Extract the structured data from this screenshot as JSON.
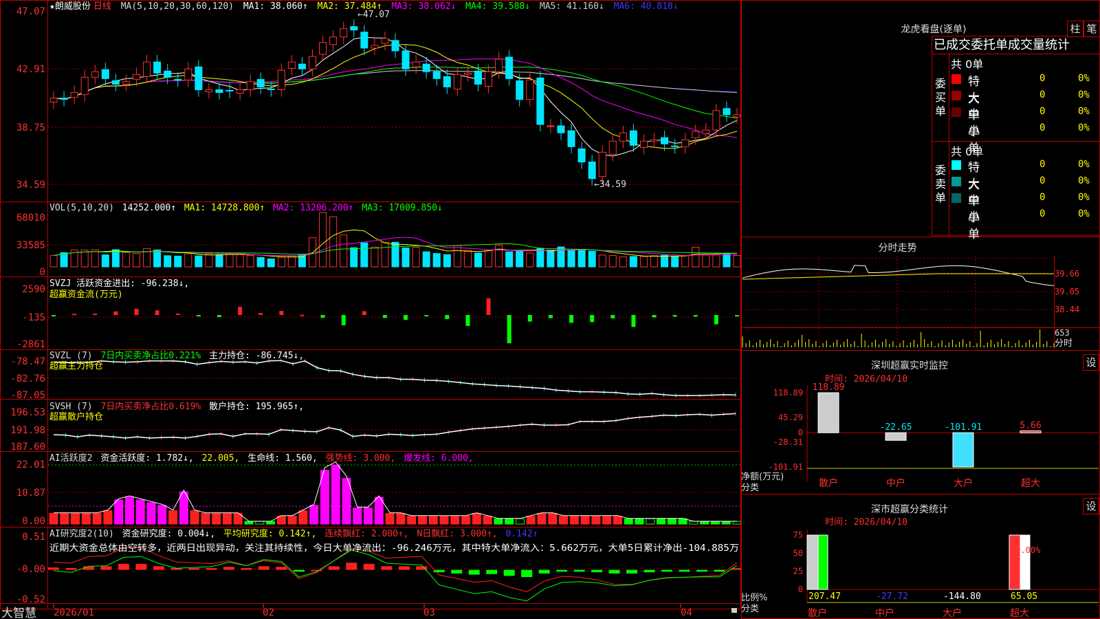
{
  "stock": {
    "star": "★",
    "name": "朗威股份",
    "period": "日线"
  },
  "price": {
    "header": {
      "ma_def": "MA(5,10,20,30,60,120)",
      "ma1": "MA1: 38.060↑",
      "ma2": "MA2: 37.484↑",
      "ma3": "MA3: 38.062↓",
      "ma4": "MA4: 39.588↓",
      "ma5": "MA5: 41.160↓",
      "ma6": "MA6: 40.818↓"
    },
    "y_ticks": [
      "47.07",
      "42.91",
      "38.75",
      "34.59"
    ],
    "high_label": "47.07",
    "low_label": "34.59"
  },
  "vol": {
    "header": {
      "def": "VOL(5,10,20)",
      "v": "14252.000↑",
      "ma1": "MA1: 14728.800↑",
      "ma2": "MA2: 13206.200↑",
      "ma3": "MA3: 17009.850↓"
    },
    "y_ticks": [
      "68010",
      "33585",
      "0"
    ]
  },
  "svzj": {
    "line1": "SVZJ  活跃资金进出: -96.238↓,",
    "line2": "超赢资金流(万元)",
    "y_ticks": [
      "2590",
      "-135",
      "-2861"
    ]
  },
  "svzl": {
    "h1": "SVZL (7)",
    "h2": "7日内买卖净占比0.221%",
    "h3": "主力持仓: -86.745↓,",
    "line2": "超赢主力持仓",
    "y_ticks": [
      "-78.47",
      "-82.76",
      "-87.05"
    ]
  },
  "svsh": {
    "h1": "SVSH (7)",
    "h2": "7日内买卖净占比0.619%",
    "h3": "散户持仓: 195.965↑,",
    "line2": "超赢散户持仓",
    "y_ticks": [
      "196.53",
      "191.98",
      "187.60"
    ]
  },
  "ai1": {
    "h1": "AI活跃度2",
    "h2": "资金活跃度: 1.782↓,",
    "h3": "22.005,",
    "h4": "生命线: 1.560,",
    "h5": "强势线: 3.000,",
    "h6": "爆发线: 6.000,",
    "y_ticks": [
      "22.01",
      "10.87",
      "0.00"
    ]
  },
  "ai2": {
    "h1": "AI研究度2(10)",
    "h2": "资金研究度: 0.004↓,",
    "h3": "平均研究度: 0.142↑,",
    "h4": "连续飘红: 2.000↑,",
    "h5": "N日飘红: 3.000↑,",
    "h6": "0.142↑",
    "note": "近期大资金总体由空转多，近两日出现异动，关注其持续性，今日大单净流出：-96.246万元，其中特大单净流入：5.662万元，大单5日累计净出-104.885万",
    "y_ticks": [
      "0.51",
      "-0.00",
      "-0.52"
    ]
  },
  "x_axis": [
    "2026/01",
    "02",
    "03",
    "04"
  ],
  "brand": "大智慧",
  "side": {
    "title": "龙虎看盘(逐单)",
    "btn1": "柱",
    "btn2": "笔",
    "table_title": "已成交委托单成交量统计",
    "buy": {
      "side": "委买单",
      "total": "共 0单",
      "rows": [
        {
          "label": "特大",
          "v": "0",
          "p": "0%",
          "color": "#ff0000"
        },
        {
          "label": "大单",
          "v": "0",
          "p": "0%",
          "color": "#990000"
        },
        {
          "label": "中单",
          "v": "0",
          "p": "0%",
          "color": "#660000"
        },
        {
          "label": "小单",
          "v": "0",
          "p": "0%",
          "color": "#000000"
        }
      ]
    },
    "sell": {
      "side": "委卖单",
      "total": "共 0单",
      "rows": [
        {
          "label": "特大",
          "v": "0",
          "p": "0%",
          "color": "#00ffff"
        },
        {
          "label": "大单",
          "v": "0",
          "p": "0%",
          "color": "#009999"
        },
        {
          "label": "中单",
          "v": "0",
          "p": "0%",
          "color": "#006666"
        },
        {
          "label": "小单",
          "v": "0",
          "p": "0%",
          "color": "#000000"
        }
      ]
    },
    "fenshi": {
      "title": "分时走势",
      "y_ticks": [
        "39.66",
        "39.05",
        "38.44"
      ],
      "vol_label": "653",
      "unit": "分时"
    },
    "monitor": {
      "title": "深圳超赢实时监控",
      "btn": "设",
      "date": "时间: 2026/04/10",
      "y_ticks": [
        "118.89",
        "45.29",
        "0",
        "-28.31",
        "-101.91"
      ],
      "unit1": "净额(万元)",
      "unit2": "分类",
      "cats": [
        "散户",
        "中户",
        "大户",
        "超大"
      ],
      "values": [
        118.89,
        -22.65,
        -101.91,
        5.66
      ],
      "labels": [
        "118.89",
        "-22.65",
        "-101.91",
        "5.66"
      ]
    },
    "classify": {
      "title": "深市超赢分类统计",
      "btn": "设",
      "date": "时间: 2026/04/10",
      "y_ticks": [
        "75",
        "50",
        "25",
        "0"
      ],
      "unit1": "比例%",
      "unit2": "分类",
      "cats": [
        "散户",
        "中户",
        "大户",
        "超大"
      ],
      "pcts": [
        100,
        0,
        0,
        100
      ],
      "labels": [
        "207.47",
        "-27.72",
        "-144.80",
        "65.05"
      ],
      "top_label": "+0.00%"
    }
  },
  "chart_data": [
    {
      "type": "candlestick",
      "title": "朗威股份 日线",
      "x": [
        "2026/01",
        "02",
        "03",
        "04"
      ],
      "ylim": [
        34.59,
        47.07
      ],
      "y_ticks": [
        47.07,
        42.91,
        38.75,
        34.59
      ],
      "high": 47.07,
      "low": 34.59,
      "close": [
        40.8,
        40.7,
        41.2,
        42.3,
        42.7,
        42.2,
        41.8,
        42.0,
        42.5,
        43.4,
        42.6,
        42.3,
        42.1,
        42.9,
        41.4,
        41.4,
        41.2,
        41.3,
        41.4,
        42.0,
        41.6,
        41.4,
        42.8,
        43.4,
        42.9,
        43.8,
        44.8,
        45.2,
        45.8,
        45.7,
        44.4,
        44.6,
        45.1,
        44.2,
        42.9,
        43.4,
        42.7,
        42.2,
        41.6,
        42.5,
        42.6,
        41.8,
        42.7,
        43.6,
        42.2,
        40.7,
        42.1,
        38.9,
        38.8,
        38.3,
        37.3,
        36.2,
        35.0,
        36.9,
        37.7,
        38.3,
        37.4,
        37.7,
        37.8,
        37.5,
        37.3,
        37.8,
        38.4,
        38.5,
        39.9,
        39.6,
        39.6
      ]
    },
    {
      "type": "bar",
      "title": "VOL(5,10,20)",
      "ylim": [
        0,
        68010
      ],
      "values": [
        14252,
        17800,
        21300,
        21000,
        21500,
        15000,
        21500,
        18000,
        16800,
        22900,
        21200,
        14000,
        13500,
        16400,
        13700,
        16400,
        15400,
        16100,
        15800,
        14200,
        11800,
        10000,
        12200,
        13500,
        15400,
        36500,
        68010,
        62700,
        40200,
        24000,
        30000,
        24800,
        30700,
        30800,
        23700,
        24500,
        18900,
        16700,
        15300,
        26500,
        20500,
        17300,
        20500,
        27300,
        18800,
        19800,
        17300,
        22800,
        20600,
        25000,
        20400,
        21600,
        19500,
        14700,
        14200,
        12500,
        13000,
        13000,
        14000,
        14500,
        13000,
        14000,
        24500,
        14700,
        15000,
        16500,
        14252
      ]
    },
    {
      "type": "bar",
      "title": "超赢资金流(万元)",
      "ylim": [
        -2861,
        2590
      ],
      "values": [
        -10,
        120,
        140,
        360,
        620,
        460,
        140,
        -40,
        -210,
        820,
        190,
        410,
        20,
        -270,
        -1010,
        380,
        -290,
        -490,
        -95,
        -400,
        -1080,
        1660,
        -2800,
        -650,
        -310,
        -770,
        -700,
        -340,
        -1180,
        -240,
        -160,
        -160,
        -920,
        -140
      ]
    },
    {
      "type": "line",
      "title": "超赢主力持仓",
      "ylim": [
        -87.05,
        -78.47
      ],
      "y_ticks": [
        -78.47,
        -82.76,
        -87.05
      ],
      "values": [
        -78.9,
        -79.0,
        -78.9,
        -78.9,
        -78.6,
        -78.8,
        -78.9,
        -78.8,
        -78.6,
        -78.6,
        -78.6,
        -78.8,
        -79.4,
        -79.0,
        -78.7,
        -78.9,
        -78.8,
        -79.1,
        -78.6,
        -78.5,
        -79.3,
        -78.6,
        -80.2,
        -80.9,
        -81.0,
        -81.8,
        -82.3,
        -82.6,
        -82.6,
        -83.0,
        -83.0,
        -83.2,
        -83.3,
        -83.5,
        -83.8,
        -84.1,
        -84.3,
        -84.5,
        -84.6,
        -84.8,
        -85.0,
        -85.2,
        -85.6,
        -85.8,
        -86.0,
        -86.0,
        -86.1,
        -86.2,
        -86.5,
        -86.6,
        -86.4,
        -86.7,
        -86.9,
        -86.9,
        -86.9,
        -86.8,
        -86.7,
        -86.745
      ]
    },
    {
      "type": "line",
      "title": "超赢散户持仓",
      "ylim": [
        187.6,
        196.53
      ],
      "y_ticks": [
        196.53,
        191.98,
        187.6
      ],
      "values": [
        190.9,
        190.8,
        190.4,
        190.8,
        190.6,
        190.4,
        190.1,
        190.4,
        190.1,
        190.2,
        190.3,
        190.1,
        190.5,
        191.0,
        191.1,
        190.5,
        191.1,
        191.1,
        191.0,
        192.1,
        191.9,
        191.7,
        191.6,
        192.6,
        192.0,
        190.5,
        190.8,
        190.6,
        191.0,
        190.9,
        190.7,
        190.9,
        191.0,
        191.5,
        191.9,
        192.3,
        192.5,
        192.7,
        192.9,
        193.2,
        193.4,
        193.2,
        193.2,
        193.3,
        194.1,
        194.1,
        194.1,
        194.3,
        194.8,
        195.1,
        195.3,
        195.6,
        195.5,
        195.7,
        195.8,
        195.6,
        195.8,
        195.965
      ]
    },
    {
      "type": "bar",
      "title": "AI活跃度2",
      "ylim": [
        0,
        22.01
      ],
      "y_ticks": [
        22.01,
        10.87,
        0
      ],
      "lines": {
        "生命线": 1.56,
        "强势线": 3.0,
        "爆发线": 6.0
      },
      "values": [
        4,
        4,
        4,
        4,
        4,
        5,
        9,
        10,
        9,
        8,
        7,
        5,
        12,
        5,
        4,
        4,
        4,
        4,
        1,
        1,
        1,
        3,
        3,
        5,
        7,
        20,
        22,
        17,
        6,
        6,
        10,
        4,
        4,
        3,
        3,
        3,
        3,
        3,
        3,
        4,
        3,
        2,
        2,
        2,
        3,
        4,
        4,
        3,
        3,
        3,
        3,
        3,
        3,
        2,
        2,
        2,
        2,
        2,
        2,
        1,
        1,
        1,
        1,
        1
      ]
    },
    {
      "type": "bar",
      "title": "AI研究度2(10)",
      "ylim": [
        -0.52,
        0.51
      ],
      "y_ticks": [
        0.51,
        -0.0,
        -0.52
      ],
      "values": [
        0.04,
        0.03,
        0.06,
        0.06,
        0.1,
        0.1,
        0.06,
        0.03,
        0.03,
        0.03,
        0.05,
        0.03,
        0.06,
        0.05,
        -0.03,
        0.0,
        0.06,
        0.12,
        0.1,
        0.06,
        0.06,
        0.06,
        -0.04,
        -0.06,
        -0.08,
        -0.07,
        -0.1,
        -0.12,
        -0.06,
        -0.03,
        -0.03,
        -0.04,
        -0.06,
        -0.06,
        -0.04,
        -0.03,
        -0.03,
        -0.03,
        -0.03,
        0.03
      ]
    },
    {
      "type": "bar",
      "title": "深圳超赢实时监控",
      "categories": [
        "散户",
        "中户",
        "大户",
        "超大"
      ],
      "values": [
        118.89,
        -22.65,
        -101.91,
        5.66
      ],
      "ylim": [
        -101.91,
        118.89
      ],
      "ylabel": "净额(万元)"
    },
    {
      "type": "bar",
      "title": "深市超赢分类统计",
      "categories": [
        "散户",
        "中户",
        "大户",
        "超大"
      ],
      "values": [
        207.47,
        -27.72,
        -144.8,
        65.05
      ],
      "ylim": [
        0,
        75
      ],
      "ylabel": "比例%"
    }
  ]
}
